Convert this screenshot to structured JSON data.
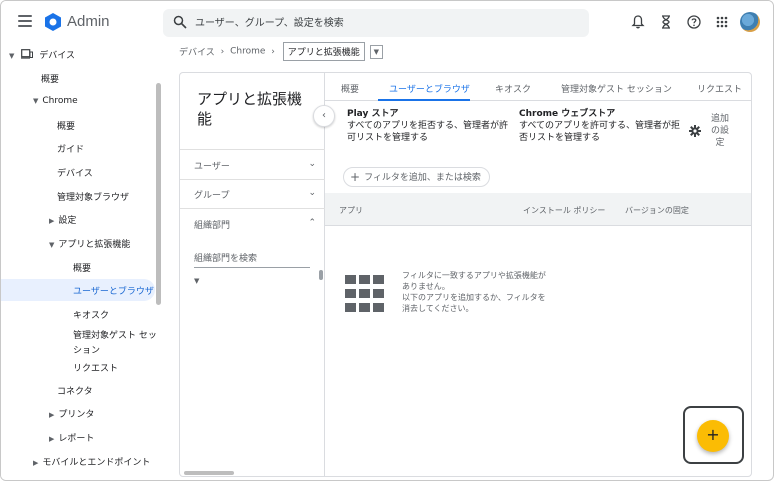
{
  "header": {
    "brand": "Admin",
    "search_placeholder": "ユーザー、グループ、設定を検索"
  },
  "icons": {
    "menu": "hamburger-icon",
    "search": "search-icon",
    "notifications": "bell-icon",
    "tasks": "hourglass-icon",
    "help": "help-icon",
    "apps": "apps-grid-icon"
  },
  "nav": {
    "devices": "デバイス",
    "overview": "概要",
    "chrome": "Chrome",
    "chrome_overview": "概要",
    "guide": "ガイド",
    "chrome_devices": "デバイス",
    "managed_browsers": "管理対象ブラウザ",
    "settings": "設定",
    "apps_extensions": "アプリと拡張機能",
    "apps_overview": "概要",
    "users_browsers": "ユーザーとブラウザ",
    "kiosk": "キオスク",
    "managed_guest_1": "管理対象ゲスト セッ",
    "managed_guest_2": "ション",
    "requests": "リクエスト",
    "connectors": "コネクタ",
    "printers": "プリンタ",
    "reports": "レポート",
    "mobile_endpoints": "モバイルとエンドポイント"
  },
  "breadcrumb": {
    "item1": "デバイス",
    "item2": "Chrome",
    "current": "アプリと拡張機能",
    "sep": "›"
  },
  "panel": {
    "title": "アプリと拡張機能",
    "users": "ユーザー",
    "groups": "グループ",
    "org_units": "組織部門",
    "org_search_placeholder": "組織部門を検索"
  },
  "tabs": [
    "概要",
    "ユーザーとブラウザ",
    "キオスク",
    "管理対象ゲスト セッション",
    "リクエスト"
  ],
  "stores": {
    "play_title": "Play ストア",
    "play_desc": "すべてのアプリを拒否する、管理者が許可リストを管理する",
    "web_title": "Chrome ウェブストア",
    "web_desc": "すべてのアプリを許可する、管理者が拒否リストを管理する",
    "additional_settings": "追加の設定"
  },
  "filter_chip": "フィルタを追加、または検索",
  "table": {
    "col_app": "アプリ",
    "col_install_policy": "インストール ポリシー",
    "col_version_pin": "バージョンの固定"
  },
  "empty_state": {
    "line1": "フィルタに一致するアプリや拡張機能がありません。",
    "line2": "以下のアプリを追加するか、フィルタを消去してください。"
  },
  "fab_label": "+",
  "colors": {
    "accent": "#1a73e8",
    "fab": "#fbbc04",
    "selected_bg": "#e8f0fe"
  }
}
